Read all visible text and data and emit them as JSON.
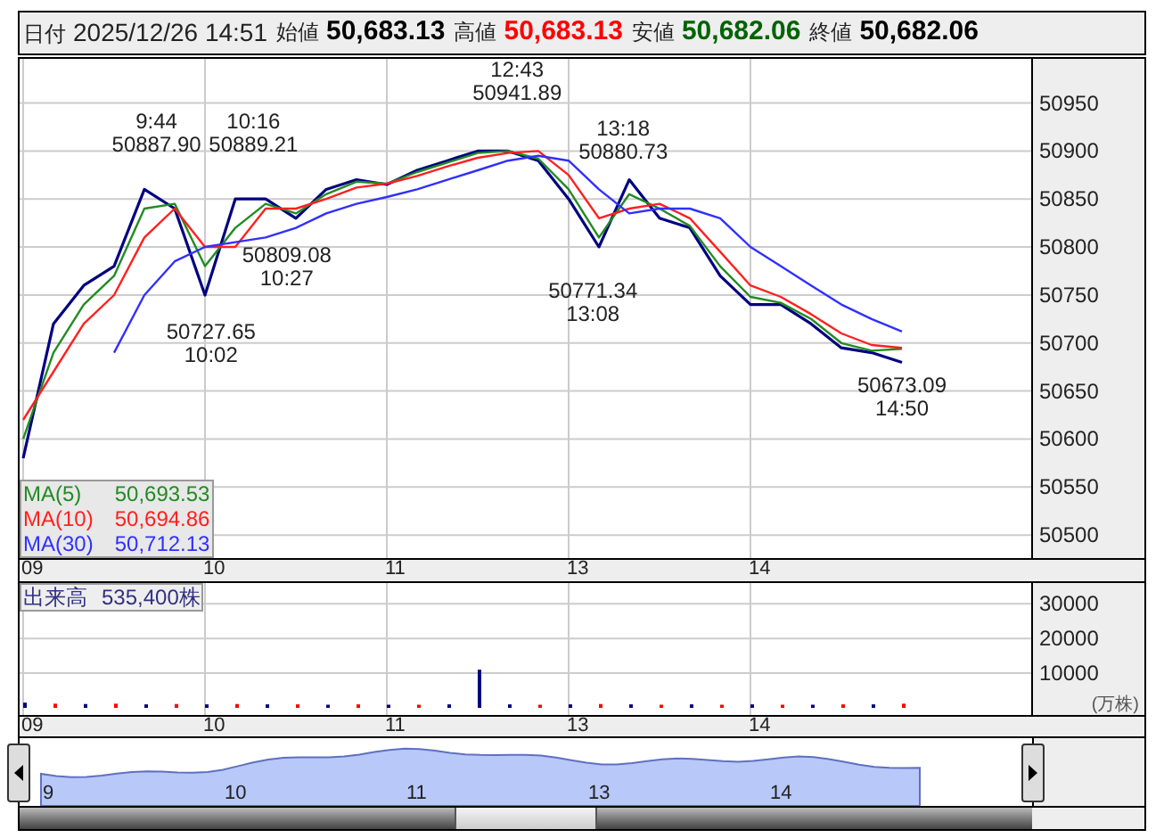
{
  "header": {
    "fields": [
      {
        "label": "日付",
        "value": "2025/12/26 14:51",
        "color": "#222222",
        "bold": false
      },
      {
        "label": "始値",
        "value": "50,683.13",
        "color": "#000000",
        "bold": true
      },
      {
        "label": "高値",
        "value": "50,683.13",
        "color": "#ff0000",
        "bold": true
      },
      {
        "label": "安値",
        "value": "50,682.06",
        "color": "#006400",
        "bold": true
      },
      {
        "label": "終値",
        "value": "50,682.06",
        "color": "#000000",
        "bold": true
      }
    ]
  },
  "price_chart": {
    "legend_values": [
      "50,693.53",
      "50,694.86",
      "50,712.13"
    ],
    "chart_data": {
      "type": "line",
      "grid": true,
      "categories": [
        "09",
        null,
        null,
        null,
        null,
        null,
        "10",
        null,
        null,
        null,
        null,
        null,
        "11",
        null,
        null,
        null,
        null,
        null,
        "13",
        null,
        null,
        null,
        null,
        null,
        "14",
        null,
        null,
        null,
        null,
        null
      ],
      "ylim": [
        50476,
        50996
      ],
      "yticks": [
        50950,
        50900,
        50850,
        50800,
        50750,
        50700,
        50650,
        50600,
        50550,
        50500
      ],
      "series": [
        {
          "color": "#000080",
          "values": [
            50580,
            50720,
            50760,
            50780,
            50860,
            50840,
            50750,
            50850,
            50850,
            50830,
            50860,
            50870,
            50865,
            50880,
            50890,
            50900,
            50900,
            50890,
            50850,
            50800,
            50870,
            50830,
            50820,
            50770,
            50740,
            50740,
            50720,
            50695,
            50690,
            50680
          ]
        },
        {
          "name": "MA(5)",
          "color": "#228b22",
          "values": [
            50600,
            50690,
            50740,
            50770,
            50840,
            50845,
            50780,
            50820,
            50845,
            50835,
            50855,
            50868,
            50866,
            50878,
            50888,
            50898,
            50900,
            50892,
            50860,
            50810,
            50855,
            50840,
            50822,
            50780,
            50748,
            50742,
            50725,
            50700,
            50692,
            50694
          ]
        },
        {
          "name": "MA(10)",
          "color": "#ff2020",
          "values": [
            50620,
            50670,
            50720,
            50750,
            50810,
            50840,
            50800,
            50800,
            50840,
            50840,
            50850,
            50862,
            50866,
            50874,
            50884,
            50893,
            50898,
            50900,
            50875,
            50830,
            50840,
            50845,
            50830,
            50795,
            50760,
            50748,
            50730,
            50710,
            50698,
            50695
          ]
        },
        {
          "name": "MA(30)",
          "color": "#3030ff",
          "values": [
            null,
            null,
            null,
            50690,
            50750,
            50785,
            50800,
            50805,
            50810,
            50820,
            50835,
            50845,
            50852,
            50860,
            50870,
            50880,
            50890,
            50895,
            50890,
            50860,
            50835,
            50840,
            50840,
            50830,
            50800,
            50780,
            50760,
            50740,
            50725,
            50712
          ]
        }
      ],
      "annotations": [
        "9:44\n50887.90",
        "10:16\n50889.21",
        "12:43\n50941.89",
        "13:18\n50880.73",
        "50727.65\n10:02",
        "50809.08\n10:27",
        "50771.34\n13:08",
        "50673.09\n14:50"
      ]
    }
  },
  "volume_chart": {
    "legend_name": "出来高",
    "legend_value": "535,400株",
    "unit": "(万株)",
    "chart_data": {
      "type": "bar",
      "grid": true,
      "categories": [
        "09",
        null,
        null,
        null,
        null,
        null,
        "10",
        null,
        null,
        null,
        null,
        null,
        "11",
        null,
        null,
        null,
        null,
        null,
        "13",
        null,
        null,
        null,
        null,
        null,
        "14",
        null,
        null,
        null,
        null,
        null
      ],
      "ylim": [
        0,
        36000
      ],
      "yticks": [
        30000,
        20000,
        10000
      ],
      "series": [
        {
          "color": "#000080",
          "values": [
            1500,
            null,
            1100,
            null,
            1000,
            null,
            1000,
            null,
            1000,
            null,
            900,
            null,
            900,
            null,
            1000,
            11000,
            1000,
            null,
            1000,
            null,
            1000,
            null,
            1000,
            null,
            1000,
            null,
            900,
            null,
            1000,
            null
          ]
        },
        {
          "color": "#ff0000",
          "values": [
            null,
            1200,
            null,
            1200,
            null,
            1100,
            null,
            1100,
            null,
            1000,
            null,
            1000,
            null,
            900,
            null,
            null,
            null,
            900,
            null,
            1100,
            null,
            900,
            null,
            900,
            null,
            900,
            null,
            1000,
            null,
            1200
          ]
        }
      ]
    }
  },
  "navigator": {
    "labels": [
      "9",
      "10",
      "11",
      "13",
      "14"
    ]
  }
}
